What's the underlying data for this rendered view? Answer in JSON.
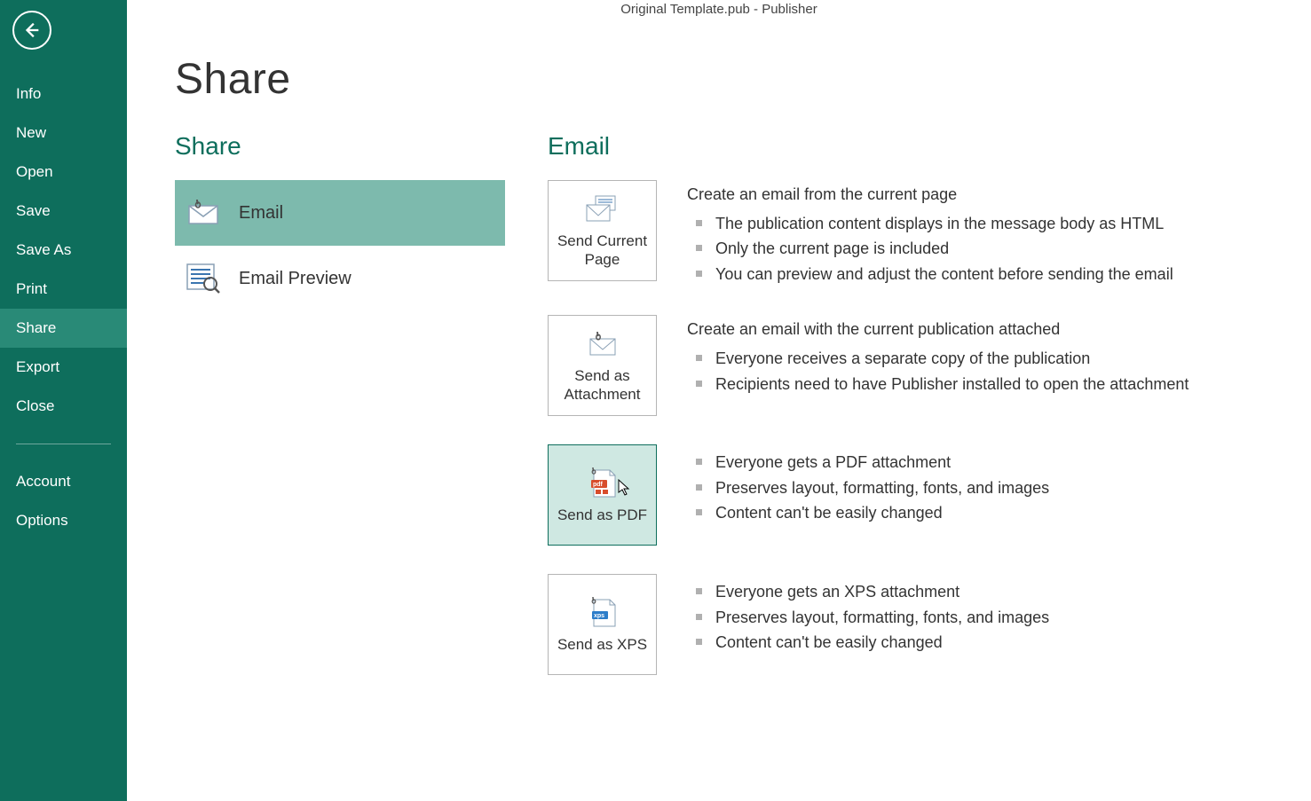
{
  "window_title": "Original Template.pub - Publisher",
  "page_title": "Share",
  "sidebar": {
    "items": [
      {
        "label": "Info"
      },
      {
        "label": "New"
      },
      {
        "label": "Open"
      },
      {
        "label": "Save"
      },
      {
        "label": "Save As"
      },
      {
        "label": "Print"
      },
      {
        "label": "Share"
      },
      {
        "label": "Export"
      },
      {
        "label": "Close"
      }
    ],
    "footer": [
      {
        "label": "Account"
      },
      {
        "label": "Options"
      }
    ]
  },
  "share_section": {
    "title": "Share",
    "options": [
      {
        "label": "Email"
      },
      {
        "label": "Email Preview"
      }
    ]
  },
  "email_section": {
    "title": "Email",
    "blocks": [
      {
        "button": "Send Current Page",
        "heading": "Create an email from the current page",
        "bullets": [
          "The publication content displays in the message body as HTML",
          "Only the current page is included",
          "You can preview and adjust the content before sending the email"
        ]
      },
      {
        "button": "Send as Attachment",
        "heading": "Create an email with the current publication attached",
        "bullets": [
          "Everyone receives a separate copy of the publication",
          "Recipients need to have Publisher installed to open the attachment"
        ]
      },
      {
        "button": "Send as PDF",
        "heading": "",
        "bullets": [
          "Everyone gets a PDF attachment",
          "Preserves layout, formatting, fonts, and images",
          "Content can't be easily changed"
        ]
      },
      {
        "button": "Send as XPS",
        "heading": "",
        "bullets": [
          "Everyone gets an XPS attachment",
          "Preserves layout, formatting, fonts, and images",
          "Content can't be easily changed"
        ]
      }
    ]
  }
}
